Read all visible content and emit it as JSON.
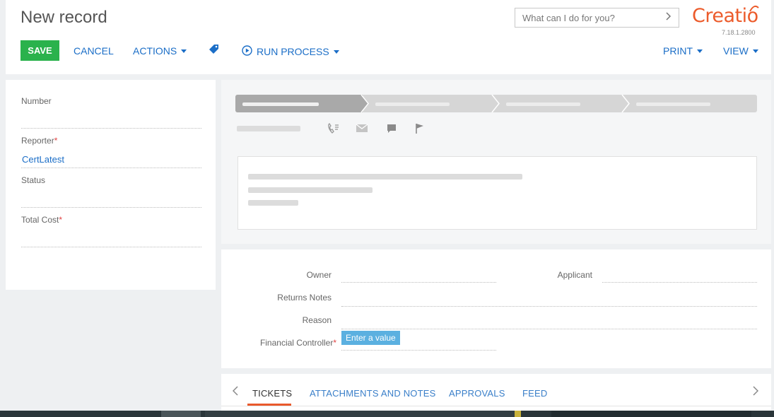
{
  "header": {
    "title": "New record",
    "search_placeholder": "What can I do for you?",
    "logo_text": "Creatio",
    "version": "7.18.1.2800"
  },
  "toolbar": {
    "save_label": "SAVE",
    "cancel_label": "CANCEL",
    "actions_label": "ACTIONS",
    "run_process_label": "RUN PROCESS",
    "print_label": "PRINT",
    "view_label": "VIEW"
  },
  "left_fields": [
    {
      "label": "Number",
      "required": "",
      "value": ""
    },
    {
      "label": "Reporter",
      "required": "*",
      "value": "CertLatest"
    },
    {
      "label": "Status",
      "required": "",
      "value": ""
    },
    {
      "label": "Total Cost",
      "required": "*",
      "value": ""
    }
  ],
  "info_fields": {
    "owner_label": "Owner",
    "applicant_label": "Applicant",
    "returns_notes_label": "Returns Notes",
    "reason_label": "Reason",
    "financial_controller_label": "Financial Controller",
    "financial_controller_required": "*",
    "enter_value_label": "Enter a value"
  },
  "tabs": [
    {
      "label": "TICKETS",
      "active": true
    },
    {
      "label": "ATTACHMENTS AND NOTES",
      "active": false
    },
    {
      "label": "APPROVALS",
      "active": false
    },
    {
      "label": "FEED",
      "active": false
    }
  ],
  "colors": {
    "accent_blue": "#1b6ec7",
    "save_green": "#2ab24c",
    "brand_orange": "#ec5b2b",
    "required_red": "#e14343",
    "tab_underline": "#e9592c"
  },
  "icons": {
    "search_arrow": "chevron-right-icon",
    "tag": "tag-icon",
    "run_process": "play-circle-icon",
    "call": "phone-icon",
    "email": "envelope-icon",
    "comment": "comment-icon",
    "flag": "flag-icon",
    "tab_prev": "chevron-left-icon",
    "tab_next": "chevron-right-icon"
  }
}
